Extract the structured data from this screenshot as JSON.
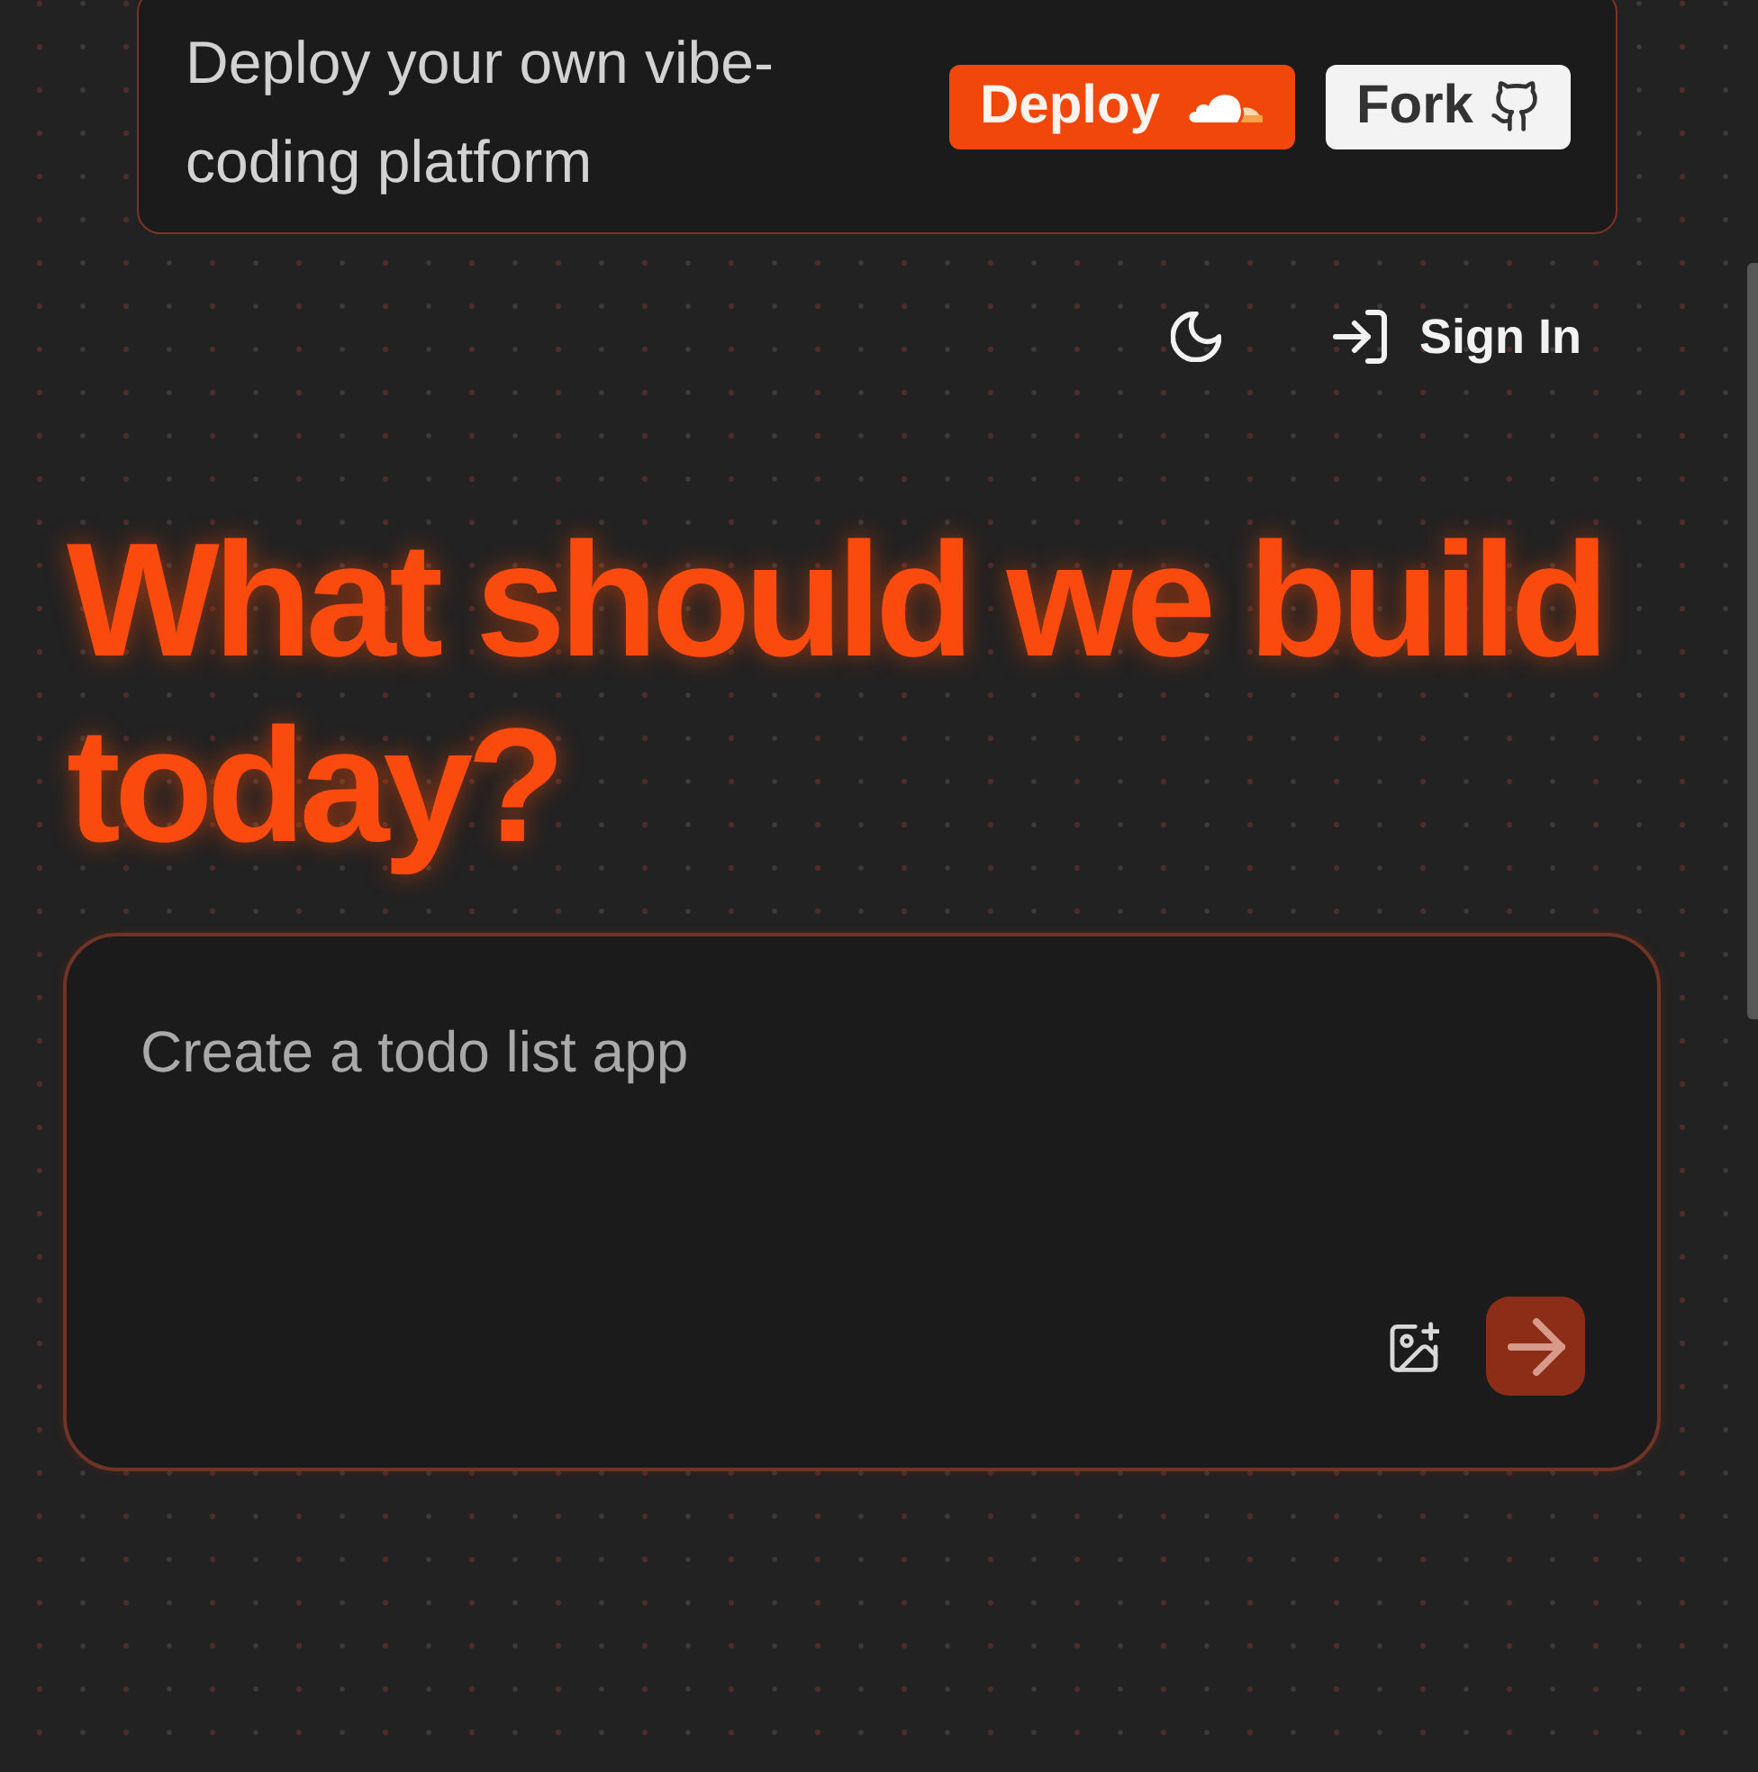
{
  "banner": {
    "text": "Deploy your own vibe-coding platform",
    "buttons": [
      {
        "kind": "deploy",
        "label": "Deploy"
      },
      {
        "kind": "fork",
        "label": "Fork"
      }
    ]
  },
  "header": {
    "sign_in": {
      "label": "Sign In"
    }
  },
  "hero": {
    "title": "What should we build today?"
  },
  "prompt": {
    "placeholder": "Create a todo list app",
    "send_button": {
      "disabled": true
    }
  }
}
